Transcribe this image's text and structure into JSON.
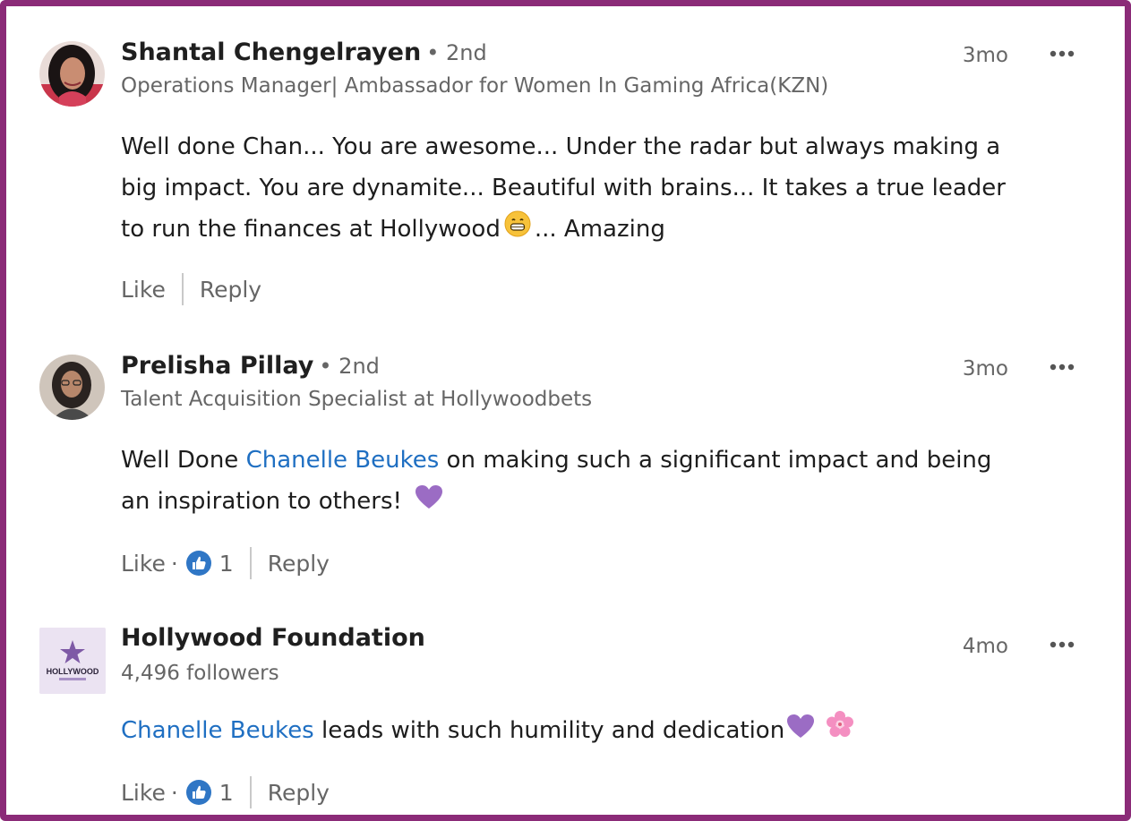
{
  "colors": {
    "frame": "#8b2b78",
    "mention": "#1f6fc2",
    "like_badge": "#2f76c5",
    "heart": "#9b6cc4",
    "flower": "#f48fc1",
    "muted_text": "#666666"
  },
  "comments": [
    {
      "name": "Shantal Chengelrayen",
      "degree": "• 2nd",
      "subtitle": "Operations Manager| Ambassador for Women In Gaming Africa(KZN)",
      "timestamp": "3mo",
      "avatar_icon": "profile-photo",
      "text_line_1": "Well done Chan... You are awesome... Under the radar but always making a",
      "text_line_2": "big impact. You are dynamite... Beautiful with brains... It takes a true leader",
      "text_line_3a": "to run the finances at Hollywood",
      "emoji_1": "grinning-face-emoji",
      "text_line_3b": "... Amazing",
      "like_label": "Like",
      "reply_label": "Reply"
    },
    {
      "name": "Prelisha Pillay",
      "degree": "• 2nd",
      "subtitle": "Talent Acquisition Specialist at Hollywoodbets",
      "timestamp": "3mo",
      "avatar_icon": "profile-photo",
      "text_prefix": "Well Done ",
      "mention": "Chanelle Beukes",
      "text_suffix_line_1": " on making such a significant impact and being",
      "text_line_2": "an inspiration to others!",
      "emoji_1": "purple-heart-emoji",
      "like_label": "Like",
      "like_dot": "·",
      "reaction_icon": "thumbs-up-icon",
      "reaction_count": "1",
      "reply_label": "Reply"
    },
    {
      "name": "Hollywood Foundation",
      "subtitle": "4,496 followers",
      "timestamp": "4mo",
      "avatar_icon": "hollywood-foundation-logo",
      "mention": "Chanelle Beukes",
      "text_suffix": " leads with such humility and dedication",
      "emoji_1": "purple-heart-emoji",
      "emoji_2": "cherry-blossom-emoji",
      "like_label": "Like",
      "like_dot": "·",
      "reaction_icon": "thumbs-up-icon",
      "reaction_count": "1",
      "reply_label": "Reply",
      "logo_text": "HOLLYWOOD"
    }
  ]
}
